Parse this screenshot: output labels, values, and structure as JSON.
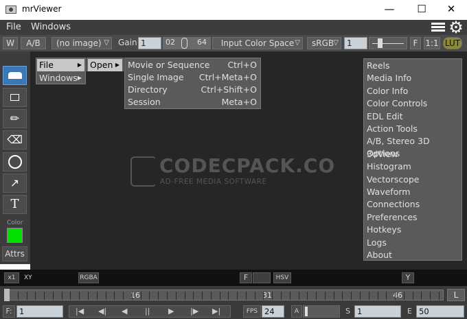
{
  "window": {
    "title": "mrViewer",
    "minimize": "—",
    "maximize": "☐",
    "close": "✕"
  },
  "menubar": {
    "items": [
      "File",
      "Windows"
    ]
  },
  "toolbar": {
    "w_button": "W",
    "ab_button": "A/B",
    "image_select": "(no image)",
    "gain_label": "Gain",
    "gain_value": "1",
    "gamma_low": "02",
    "gamma_high": "64",
    "input_color_space": "Input Color Space",
    "display_space": "sRGB",
    "exposure_value": "1",
    "f_button": "F",
    "ratio_button": "1:1",
    "lut_button": "LUT"
  },
  "tools": {
    "color_label": "Color",
    "attrs_label": "Attrs",
    "color_swatch": "#00e000"
  },
  "context_menu": {
    "level1": [
      {
        "label": "File",
        "arrow": "▶",
        "selected": true
      },
      {
        "label": "Windows",
        "arrow": "▶",
        "selected": false
      }
    ],
    "level2": [
      {
        "label": "Open",
        "arrow": "▶",
        "selected": true
      }
    ],
    "level3": [
      {
        "label": "Movie or Sequence",
        "shortcut": "Ctrl+O"
      },
      {
        "label": "Single Image",
        "shortcut": "Ctrl+Meta+O"
      },
      {
        "label": "Directory",
        "shortcut": "Ctrl+Shift+O"
      },
      {
        "label": "Session",
        "shortcut": "Meta+O"
      }
    ]
  },
  "windows_menu": {
    "items": [
      "Reels",
      "Media Info",
      "Color Info",
      "Color Controls",
      "EDL Edit",
      "Action Tools",
      "A/B, Stereo 3D Options",
      "3dView",
      "Histogram",
      "Vectorscope",
      "Waveform",
      "Connections",
      "Preferences",
      "Hotkeys",
      "Logs",
      "About"
    ]
  },
  "watermark": {
    "main": "CODECPACK.CO",
    "sub": "AD-FREE MEDIA SOFTWARE"
  },
  "infobar": {
    "zoom": "x1",
    "xy": "XY",
    "rgba": "RGBA",
    "f_button": "F",
    "hsv": "HSV",
    "y_button": "Y"
  },
  "timeline": {
    "labels": [
      "16",
      "31",
      "46"
    ],
    "loop_button": "L"
  },
  "playbar": {
    "frame_label": "F:",
    "frame_value": "1",
    "fps_label": "FPS",
    "fps_value": "24",
    "audio_label": "A",
    "start_label": "S",
    "start_value": "1",
    "end_label": "E",
    "end_value": "50",
    "transport": [
      "|◀",
      "◀|",
      "◀",
      "||",
      "▶",
      "|▶",
      "▶|"
    ]
  }
}
